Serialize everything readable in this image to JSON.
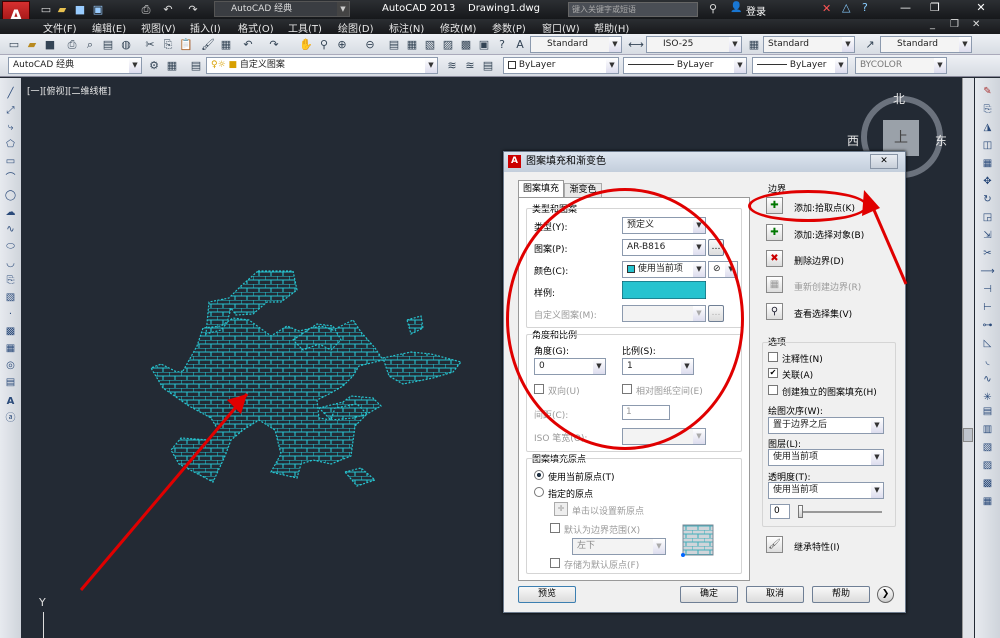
{
  "title_bar": {
    "workspace": "AutoCAD 经典",
    "app_title": "AutoCAD 2013",
    "document": "Drawing1.dwg",
    "search_placeholder": "键入关键字或短语",
    "login": "登录"
  },
  "menu": [
    "文件(F)",
    "编辑(E)",
    "视图(V)",
    "插入(I)",
    "格式(O)",
    "工具(T)",
    "绘图(D)",
    "标注(N)",
    "修改(M)",
    "参数(P)",
    "窗口(W)",
    "帮助(H)"
  ],
  "toolbar": {
    "text_style": "Standard",
    "dim_style": "ISO-25",
    "table_style": "Standard",
    "mleader_style": "Standard",
    "workspace_combo": "AutoCAD 经典",
    "layer": "自定义图案",
    "color": "ByLayer",
    "linetype": "ByLayer",
    "lineweight": "ByLayer",
    "plotstyle": "BYCOLOR"
  },
  "viewport": {
    "label": "[一][俯视][二维线框]",
    "y_axis": "Y",
    "compass": {
      "north": "北",
      "south": "",
      "east": "东",
      "west": "西",
      "center": "上"
    }
  },
  "dialog": {
    "title": "图案填充和渐变色",
    "tabs": [
      "图案填充",
      "渐变色"
    ],
    "type_pattern": {
      "group": "类型和图案",
      "type_label": "类型(Y):",
      "type_value": "预定义",
      "pattern_label": "图案(P):",
      "pattern_value": "AR-B816",
      "color_label": "颜色(C):",
      "color_value": "使用当前项",
      "sample_label": "样例:",
      "custom_label": "自定义图案(M):"
    },
    "angle_scale": {
      "group": "角度和比例",
      "angle_label": "角度(G):",
      "angle_value": "0",
      "scale_label": "比例(S):",
      "scale_value": "1",
      "double_label": "双向(U)",
      "relative_label": "相对图纸空间(E)",
      "spacing_label": "间距(C):",
      "spacing_value": "1",
      "iso_label": "ISO 笔宽(O):"
    },
    "origin": {
      "group": "图案填充原点",
      "use_current": "使用当前原点(T)",
      "specified": "指定的原点",
      "click_set": "单击以设置新原点",
      "default_extent": "默认为边界范围(X)",
      "position": "左下",
      "store_default": "存储为默认原点(F)"
    },
    "boundary": {
      "group": "边界",
      "add_pick": "添加:拾取点(K)",
      "add_select": "添加:选择对象(B)",
      "remove": "删除边界(D)",
      "recreate": "重新创建边界(R)",
      "view_sel": "查看选择集(V)"
    },
    "options": {
      "group": "选项",
      "annotative": "注释性(N)",
      "associative": "关联(A)",
      "separate": "创建独立的图案填充(H)",
      "draw_order_label": "绘图次序(W):",
      "draw_order_value": "置于边界之后",
      "layer_label": "图层(L):",
      "layer_value": "使用当前项",
      "transparency_label": "透明度(T):",
      "transparency_value": "使用当前项",
      "transparency_num": "0",
      "inherit": "继承特性(I)"
    },
    "buttons": {
      "preview": "预览",
      "ok": "确定",
      "cancel": "取消",
      "help": "帮助"
    }
  },
  "colors": {
    "hatch": "#27c3cf",
    "annotation": "#e00000",
    "viewport_bg": "#232a34"
  }
}
